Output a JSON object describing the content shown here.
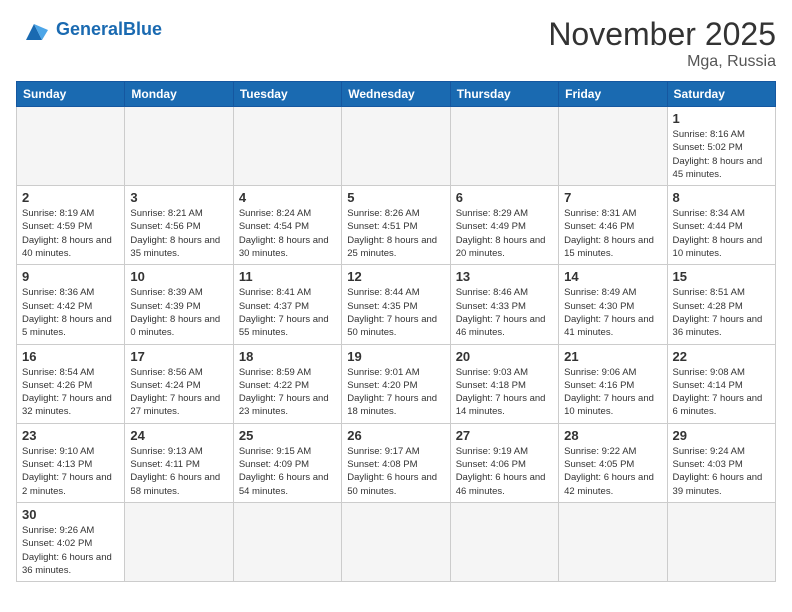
{
  "header": {
    "logo_general": "General",
    "logo_blue": "Blue",
    "month_year": "November 2025",
    "location": "Mga, Russia"
  },
  "weekdays": [
    "Sunday",
    "Monday",
    "Tuesday",
    "Wednesday",
    "Thursday",
    "Friday",
    "Saturday"
  ],
  "days": [
    {
      "num": "",
      "info": ""
    },
    {
      "num": "",
      "info": ""
    },
    {
      "num": "",
      "info": ""
    },
    {
      "num": "",
      "info": ""
    },
    {
      "num": "",
      "info": ""
    },
    {
      "num": "",
      "info": ""
    },
    {
      "num": "1",
      "info": "Sunrise: 8:16 AM\nSunset: 5:02 PM\nDaylight: 8 hours\nand 45 minutes."
    },
    {
      "num": "2",
      "info": "Sunrise: 8:19 AM\nSunset: 4:59 PM\nDaylight: 8 hours\nand 40 minutes."
    },
    {
      "num": "3",
      "info": "Sunrise: 8:21 AM\nSunset: 4:56 PM\nDaylight: 8 hours\nand 35 minutes."
    },
    {
      "num": "4",
      "info": "Sunrise: 8:24 AM\nSunset: 4:54 PM\nDaylight: 8 hours\nand 30 minutes."
    },
    {
      "num": "5",
      "info": "Sunrise: 8:26 AM\nSunset: 4:51 PM\nDaylight: 8 hours\nand 25 minutes."
    },
    {
      "num": "6",
      "info": "Sunrise: 8:29 AM\nSunset: 4:49 PM\nDaylight: 8 hours\nand 20 minutes."
    },
    {
      "num": "7",
      "info": "Sunrise: 8:31 AM\nSunset: 4:46 PM\nDaylight: 8 hours\nand 15 minutes."
    },
    {
      "num": "8",
      "info": "Sunrise: 8:34 AM\nSunset: 4:44 PM\nDaylight: 8 hours\nand 10 minutes."
    },
    {
      "num": "9",
      "info": "Sunrise: 8:36 AM\nSunset: 4:42 PM\nDaylight: 8 hours\nand 5 minutes."
    },
    {
      "num": "10",
      "info": "Sunrise: 8:39 AM\nSunset: 4:39 PM\nDaylight: 8 hours\nand 0 minutes."
    },
    {
      "num": "11",
      "info": "Sunrise: 8:41 AM\nSunset: 4:37 PM\nDaylight: 7 hours\nand 55 minutes."
    },
    {
      "num": "12",
      "info": "Sunrise: 8:44 AM\nSunset: 4:35 PM\nDaylight: 7 hours\nand 50 minutes."
    },
    {
      "num": "13",
      "info": "Sunrise: 8:46 AM\nSunset: 4:33 PM\nDaylight: 7 hours\nand 46 minutes."
    },
    {
      "num": "14",
      "info": "Sunrise: 8:49 AM\nSunset: 4:30 PM\nDaylight: 7 hours\nand 41 minutes."
    },
    {
      "num": "15",
      "info": "Sunrise: 8:51 AM\nSunset: 4:28 PM\nDaylight: 7 hours\nand 36 minutes."
    },
    {
      "num": "16",
      "info": "Sunrise: 8:54 AM\nSunset: 4:26 PM\nDaylight: 7 hours\nand 32 minutes."
    },
    {
      "num": "17",
      "info": "Sunrise: 8:56 AM\nSunset: 4:24 PM\nDaylight: 7 hours\nand 27 minutes."
    },
    {
      "num": "18",
      "info": "Sunrise: 8:59 AM\nSunset: 4:22 PM\nDaylight: 7 hours\nand 23 minutes."
    },
    {
      "num": "19",
      "info": "Sunrise: 9:01 AM\nSunset: 4:20 PM\nDaylight: 7 hours\nand 18 minutes."
    },
    {
      "num": "20",
      "info": "Sunrise: 9:03 AM\nSunset: 4:18 PM\nDaylight: 7 hours\nand 14 minutes."
    },
    {
      "num": "21",
      "info": "Sunrise: 9:06 AM\nSunset: 4:16 PM\nDaylight: 7 hours\nand 10 minutes."
    },
    {
      "num": "22",
      "info": "Sunrise: 9:08 AM\nSunset: 4:14 PM\nDaylight: 7 hours\nand 6 minutes."
    },
    {
      "num": "23",
      "info": "Sunrise: 9:10 AM\nSunset: 4:13 PM\nDaylight: 7 hours\nand 2 minutes."
    },
    {
      "num": "24",
      "info": "Sunrise: 9:13 AM\nSunset: 4:11 PM\nDaylight: 6 hours\nand 58 minutes."
    },
    {
      "num": "25",
      "info": "Sunrise: 9:15 AM\nSunset: 4:09 PM\nDaylight: 6 hours\nand 54 minutes."
    },
    {
      "num": "26",
      "info": "Sunrise: 9:17 AM\nSunset: 4:08 PM\nDaylight: 6 hours\nand 50 minutes."
    },
    {
      "num": "27",
      "info": "Sunrise: 9:19 AM\nSunset: 4:06 PM\nDaylight: 6 hours\nand 46 minutes."
    },
    {
      "num": "28",
      "info": "Sunrise: 9:22 AM\nSunset: 4:05 PM\nDaylight: 6 hours\nand 42 minutes."
    },
    {
      "num": "29",
      "info": "Sunrise: 9:24 AM\nSunset: 4:03 PM\nDaylight: 6 hours\nand 39 minutes."
    },
    {
      "num": "30",
      "info": "Sunrise: 9:26 AM\nSunset: 4:02 PM\nDaylight: 6 hours\nand 36 minutes."
    },
    {
      "num": "",
      "info": ""
    },
    {
      "num": "",
      "info": ""
    },
    {
      "num": "",
      "info": ""
    },
    {
      "num": "",
      "info": ""
    },
    {
      "num": "",
      "info": ""
    },
    {
      "num": "",
      "info": ""
    }
  ]
}
